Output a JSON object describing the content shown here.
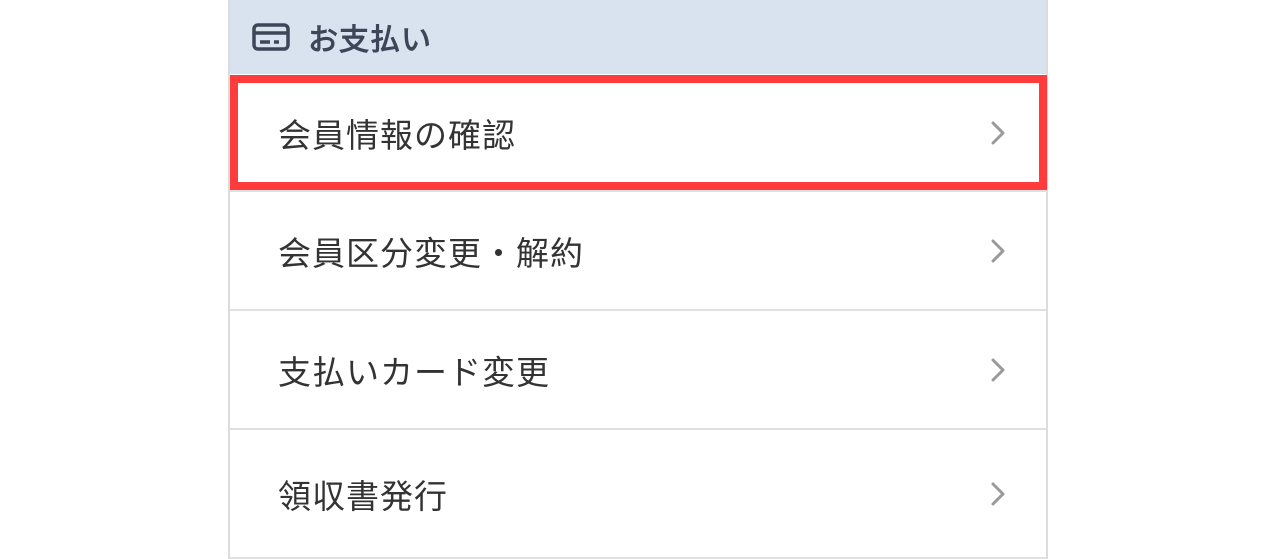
{
  "section": {
    "title": "お支払い",
    "icon": "credit-card-icon"
  },
  "menu": {
    "items": [
      {
        "label": "会員情報の確認",
        "icon": "chevron-right-icon",
        "highlighted": true
      },
      {
        "label": "会員区分変更・解約",
        "icon": "chevron-right-icon"
      },
      {
        "label": "支払いカード変更",
        "icon": "chevron-right-icon"
      },
      {
        "label": "領収書発行",
        "icon": "chevron-right-icon"
      }
    ]
  },
  "colors": {
    "header_bg": "#d9e3ef",
    "header_text": "#3b4659",
    "highlight_border": "#ff3b3b",
    "chevron": "#9a9a9a"
  }
}
